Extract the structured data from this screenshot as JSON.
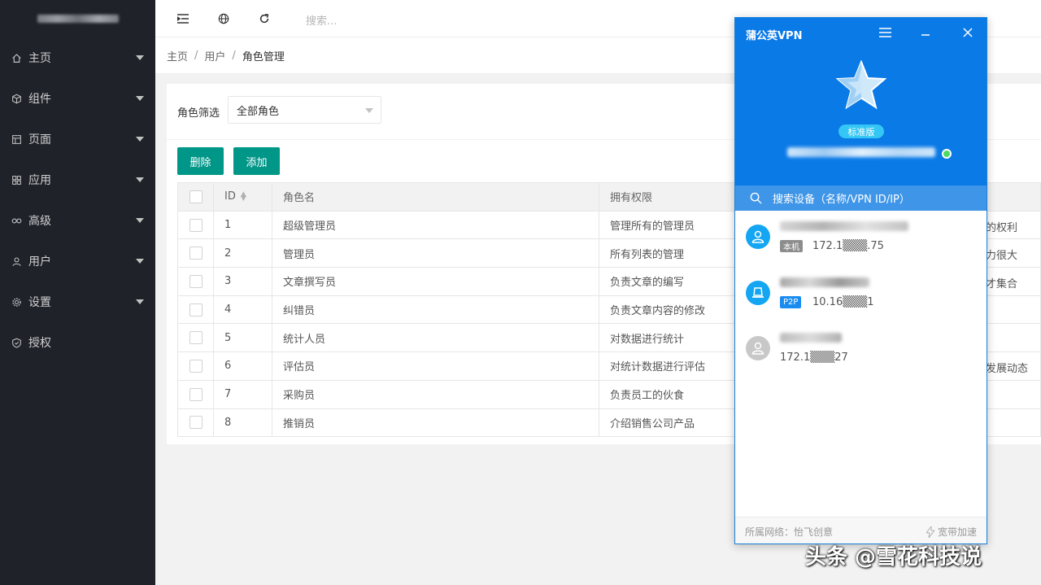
{
  "sidebar": {
    "items": [
      {
        "label": "主页",
        "icon": "home-icon",
        "caret": true
      },
      {
        "label": "组件",
        "icon": "cube-icon",
        "caret": true
      },
      {
        "label": "页面",
        "icon": "template-icon",
        "caret": true
      },
      {
        "label": "应用",
        "icon": "app-grid-icon",
        "caret": true
      },
      {
        "label": "高级",
        "icon": "senior-icon",
        "caret": true
      },
      {
        "label": "用户",
        "icon": "user-icon",
        "caret": true
      },
      {
        "label": "设置",
        "icon": "gear-icon",
        "caret": true
      },
      {
        "label": "授权",
        "icon": "shield-icon",
        "caret": false
      }
    ]
  },
  "header": {
    "search_placeholder": "搜索..."
  },
  "breadcrumb": {
    "home": "主页",
    "users": "用户",
    "current": "角色管理"
  },
  "filter": {
    "label": "角色筛选",
    "selected": "全部角色"
  },
  "buttons": {
    "delete": "删除",
    "add": "添加"
  },
  "table": {
    "columns": {
      "id": "ID",
      "name": "角色名",
      "perm": "拥有权限"
    },
    "rows": [
      {
        "id": "1",
        "name": "超级管理员",
        "perm": "管理所有的管理员",
        "desc": "上的权利"
      },
      {
        "id": "2",
        "name": "管理员",
        "perm": "所有列表的管理",
        "desc": "权力很大"
      },
      {
        "id": "3",
        "name": "文章撰写员",
        "perm": "负责文章的编写",
        "desc": "人才集合"
      },
      {
        "id": "4",
        "name": "纠错员",
        "perm": "负责文章内容的修改",
        "desc": ""
      },
      {
        "id": "5",
        "name": "统计人员",
        "perm": "对数据进行统计",
        "desc": ""
      },
      {
        "id": "6",
        "name": "评估员",
        "perm": "对统计数据进行评估",
        "desc": "场发展动态"
      },
      {
        "id": "7",
        "name": "采购员",
        "perm": "负责员工的伙食",
        "desc": ""
      },
      {
        "id": "8",
        "name": "推销员",
        "perm": "介绍销售公司产品",
        "desc": ""
      }
    ]
  },
  "vpn": {
    "title": "蒲公英VPN",
    "edition": "标准版",
    "search_label": "搜索设备（名称/VPN ID/IP）",
    "devices": [
      {
        "tag": "本机",
        "ip": "172.1▒▒▒.75",
        "status": "online",
        "tag_color": "#8d8d8d"
      },
      {
        "tag": "P2P",
        "ip": "10.16▒▒▒1",
        "status": "online",
        "tag_color": "#1a8cf0"
      },
      {
        "tag": "",
        "ip": "172.1▒▒▒27",
        "status": "offline"
      }
    ],
    "footer_network": "所属网络：怡飞创意",
    "footer_bandwidth": "宽带加速"
  },
  "watermark": "头条 @雪花科技说",
  "colors": {
    "sidebar_bg": "#20222a",
    "primary_button": "#009688",
    "vpn_blue": "#0a7ae6",
    "vpn_badge": "#34c6f4",
    "online_green": "#4cd964"
  }
}
